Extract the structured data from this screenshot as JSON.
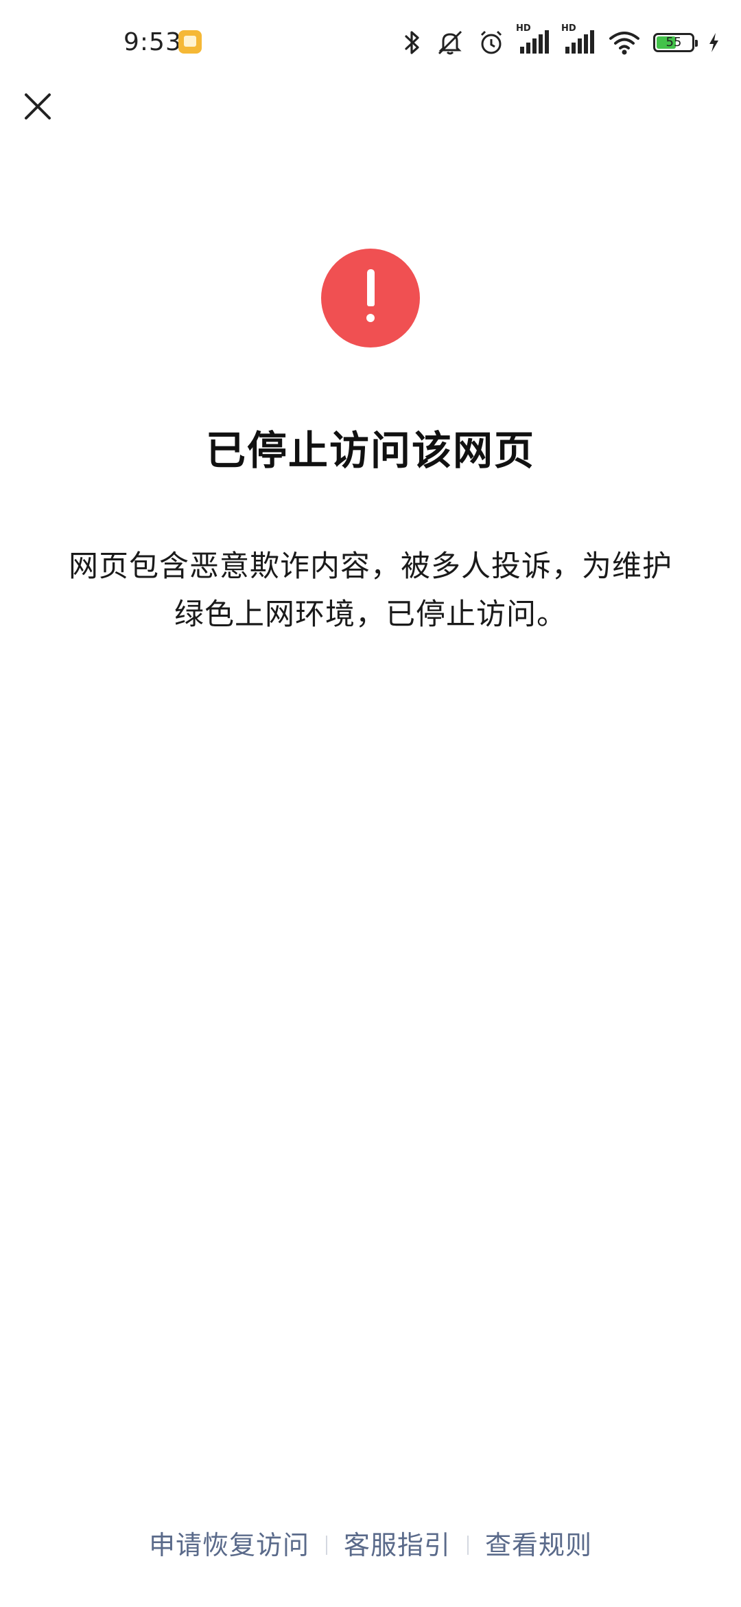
{
  "status_bar": {
    "time": "9:53",
    "battery_level": "55",
    "battery_fraction": 0.55,
    "icons": [
      "bluetooth-icon",
      "mute-icon",
      "alarm-icon",
      "hd-signal-icon",
      "hd-signal-icon",
      "wifi-icon",
      "battery-icon",
      "charging-icon"
    ],
    "hd_label": "HD"
  },
  "toolbar": {
    "close_icon": "close-icon"
  },
  "main": {
    "icon": "exclamation-icon",
    "icon_color": "#f05052",
    "title": "已停止访问该网页",
    "message": "网页包含恶意欺诈内容，被多人投诉，为维护绿色上网环境，已停止访问。"
  },
  "footer": {
    "link_color": "#5a6a8a",
    "links": [
      "申请恢复访问",
      "客服指引",
      "查看规则"
    ]
  }
}
